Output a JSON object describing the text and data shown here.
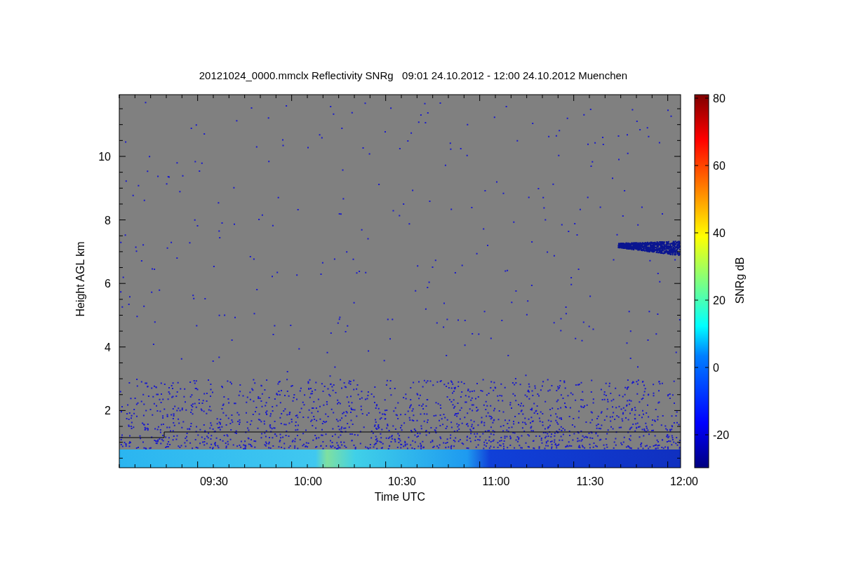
{
  "title": "20121024_0000.mmclx Reflectivity SNRg   09:01 24.10.2012 - 12:00 24.10.2012 Muenchen",
  "y_axis": {
    "label": "Height AGL km",
    "ticks": [
      "10",
      "8",
      "6",
      "4",
      "2"
    ]
  },
  "x_axis": {
    "label": "Time UTC",
    "ticks": [
      "09:30",
      "10:00",
      "10:30",
      "11:00",
      "11:30",
      "12:00"
    ]
  },
  "colorbar": {
    "label": "SNRg dB",
    "ticks": [
      "80",
      "60",
      "40",
      "20",
      "0",
      "-20"
    ]
  }
}
